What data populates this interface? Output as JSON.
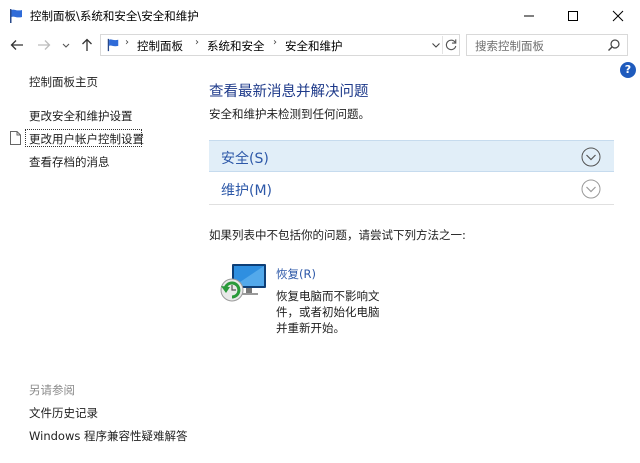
{
  "window": {
    "title": "控制面板\\系统和安全\\安全和维护"
  },
  "address": {
    "crumbs": [
      "控制面板",
      "系统和安全",
      "安全和维护"
    ],
    "separator": "›"
  },
  "search": {
    "placeholder": "搜索控制面板"
  },
  "help_label": "?",
  "sidebar": {
    "home": "控制面板主页",
    "links": [
      "更改安全和维护设置",
      "更改用户帐户控制设置",
      "查看存档的消息"
    ],
    "see_also_title": "另请参阅",
    "see_also": [
      "文件历史记录",
      "Windows 程序兼容性疑难解答"
    ]
  },
  "main": {
    "heading": "查看最新消息并解决问题",
    "subtitle": "安全和维护未检测到任何问题。",
    "sections": [
      {
        "label": "安全(S)"
      },
      {
        "label": "维护(M)"
      }
    ],
    "try_text": "如果列表中不包括你的问题，请尝试下列方法之一:",
    "recovery": {
      "link": "恢复(R)",
      "desc": [
        "恢复电脑而不影响文",
        "件，或者初始化电脑",
        "并重新开始。"
      ]
    }
  },
  "colors": {
    "accent": "#2d58a8",
    "heading": "#1e3a8a",
    "section_bg": "#e1eef8",
    "help_bg": "#1f5bbd"
  },
  "icons": [
    "flag-icon",
    "minimize-icon",
    "maximize-icon",
    "close-icon",
    "back-arrow-icon",
    "forward-arrow-icon",
    "recent-dropdown-icon",
    "up-arrow-icon",
    "dropdown-icon",
    "refresh-icon",
    "search-icon",
    "help-icon",
    "document-icon",
    "chevron-down-icon",
    "recovery-icon"
  ]
}
